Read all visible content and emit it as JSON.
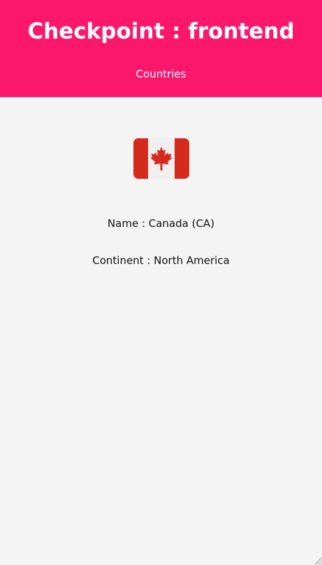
{
  "header": {
    "title": "Checkpoint : frontend",
    "nav_link": "Countries",
    "background_color": "#fb176c"
  },
  "country": {
    "flag_icon": "canada-flag-icon",
    "name_line": "Name : Canada (CA)",
    "continent_line": "Continent : North America"
  },
  "colors": {
    "page_background": "#f4f4f4",
    "flag_red": "#d52b1e",
    "flag_white": "#efefef"
  }
}
